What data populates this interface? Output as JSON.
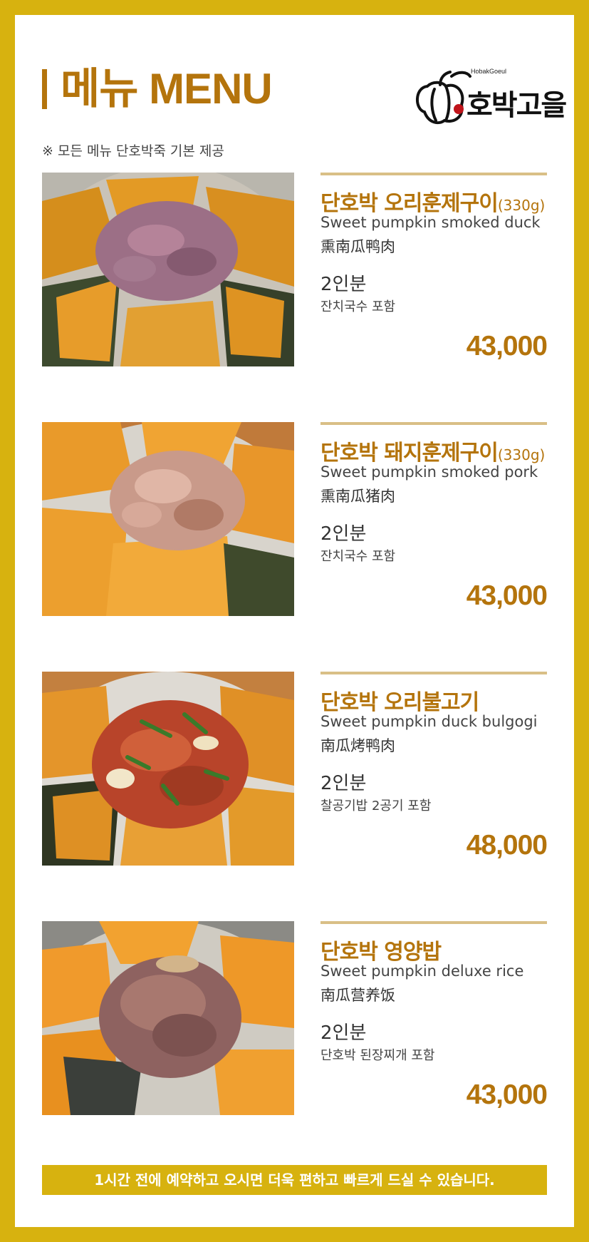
{
  "header": {
    "title": "메뉴 MENU",
    "note": "※ 모든 메뉴 단호박죽 기본 제공",
    "logo": {
      "subtitle": "HobakGoeul",
      "name": "호박고을"
    }
  },
  "colors": {
    "frame": "#d7b20f",
    "accent": "#b4740c",
    "rule": "#d9bf86"
  },
  "menu": [
    {
      "name": "단호박 오리훈제구이",
      "weight": "(330g)",
      "english": "Sweet pumpkin smoked duck",
      "chinese": "熏南瓜鸭肉",
      "servings": "2인분",
      "includes": "잔치국수 포함",
      "price": "43,000"
    },
    {
      "name": "단호박 돼지훈제구이",
      "weight": "(330g)",
      "english": "Sweet pumpkin smoked pork",
      "chinese": "熏南瓜猪肉",
      "servings": "2인분",
      "includes": "잔치국수 포함",
      "price": "43,000"
    },
    {
      "name": "단호박 오리불고기",
      "weight": "",
      "english": "Sweet pumpkin duck bulgogi",
      "chinese": "南瓜烤鸭肉",
      "servings": "2인분",
      "includes": "찰공기밥 2공기 포함",
      "price": "48,000"
    },
    {
      "name": "단호박 영양밥",
      "weight": "",
      "english": "Sweet pumpkin deluxe rice",
      "chinese": "南瓜营养饭",
      "servings": "2인분",
      "includes": "단호박 된장찌개 포함",
      "price": "43,000"
    }
  ],
  "footer": {
    "banner": "1시간 전에 예약하고 오시면 더욱 편하고 빠르게 드실 수 있습니다."
  }
}
